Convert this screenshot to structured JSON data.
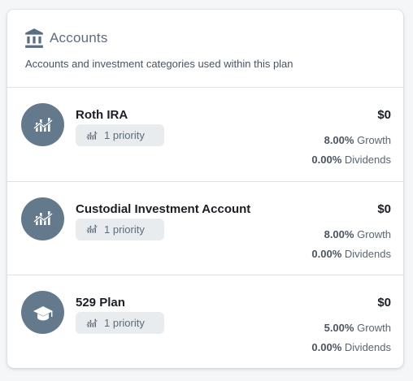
{
  "header": {
    "title": "Accounts",
    "subtitle": "Accounts and investment categories used within this plan",
    "icon": "bank-icon"
  },
  "colors": {
    "accent": "#5a6e82",
    "avatar_bg": "#647a8c",
    "chip_bg": "#e9ecef"
  },
  "accounts": [
    {
      "name": "Roth IRA",
      "icon": "chart-trend-icon",
      "priority_label": "1 priority",
      "amount": "$0",
      "growth_value": "8.00%",
      "growth_label": "Growth",
      "dividends_value": "0.00%",
      "dividends_label": "Dividends"
    },
    {
      "name": "Custodial Investment Account",
      "icon": "chart-trend-icon",
      "priority_label": "1 priority",
      "amount": "$0",
      "growth_value": "8.00%",
      "growth_label": "Growth",
      "dividends_value": "0.00%",
      "dividends_label": "Dividends"
    },
    {
      "name": "529 Plan",
      "icon": "graduation-cap-icon",
      "priority_label": "1 priority",
      "amount": "$0",
      "growth_value": "5.00%",
      "growth_label": "Growth",
      "dividends_value": "0.00%",
      "dividends_label": "Dividends"
    }
  ]
}
